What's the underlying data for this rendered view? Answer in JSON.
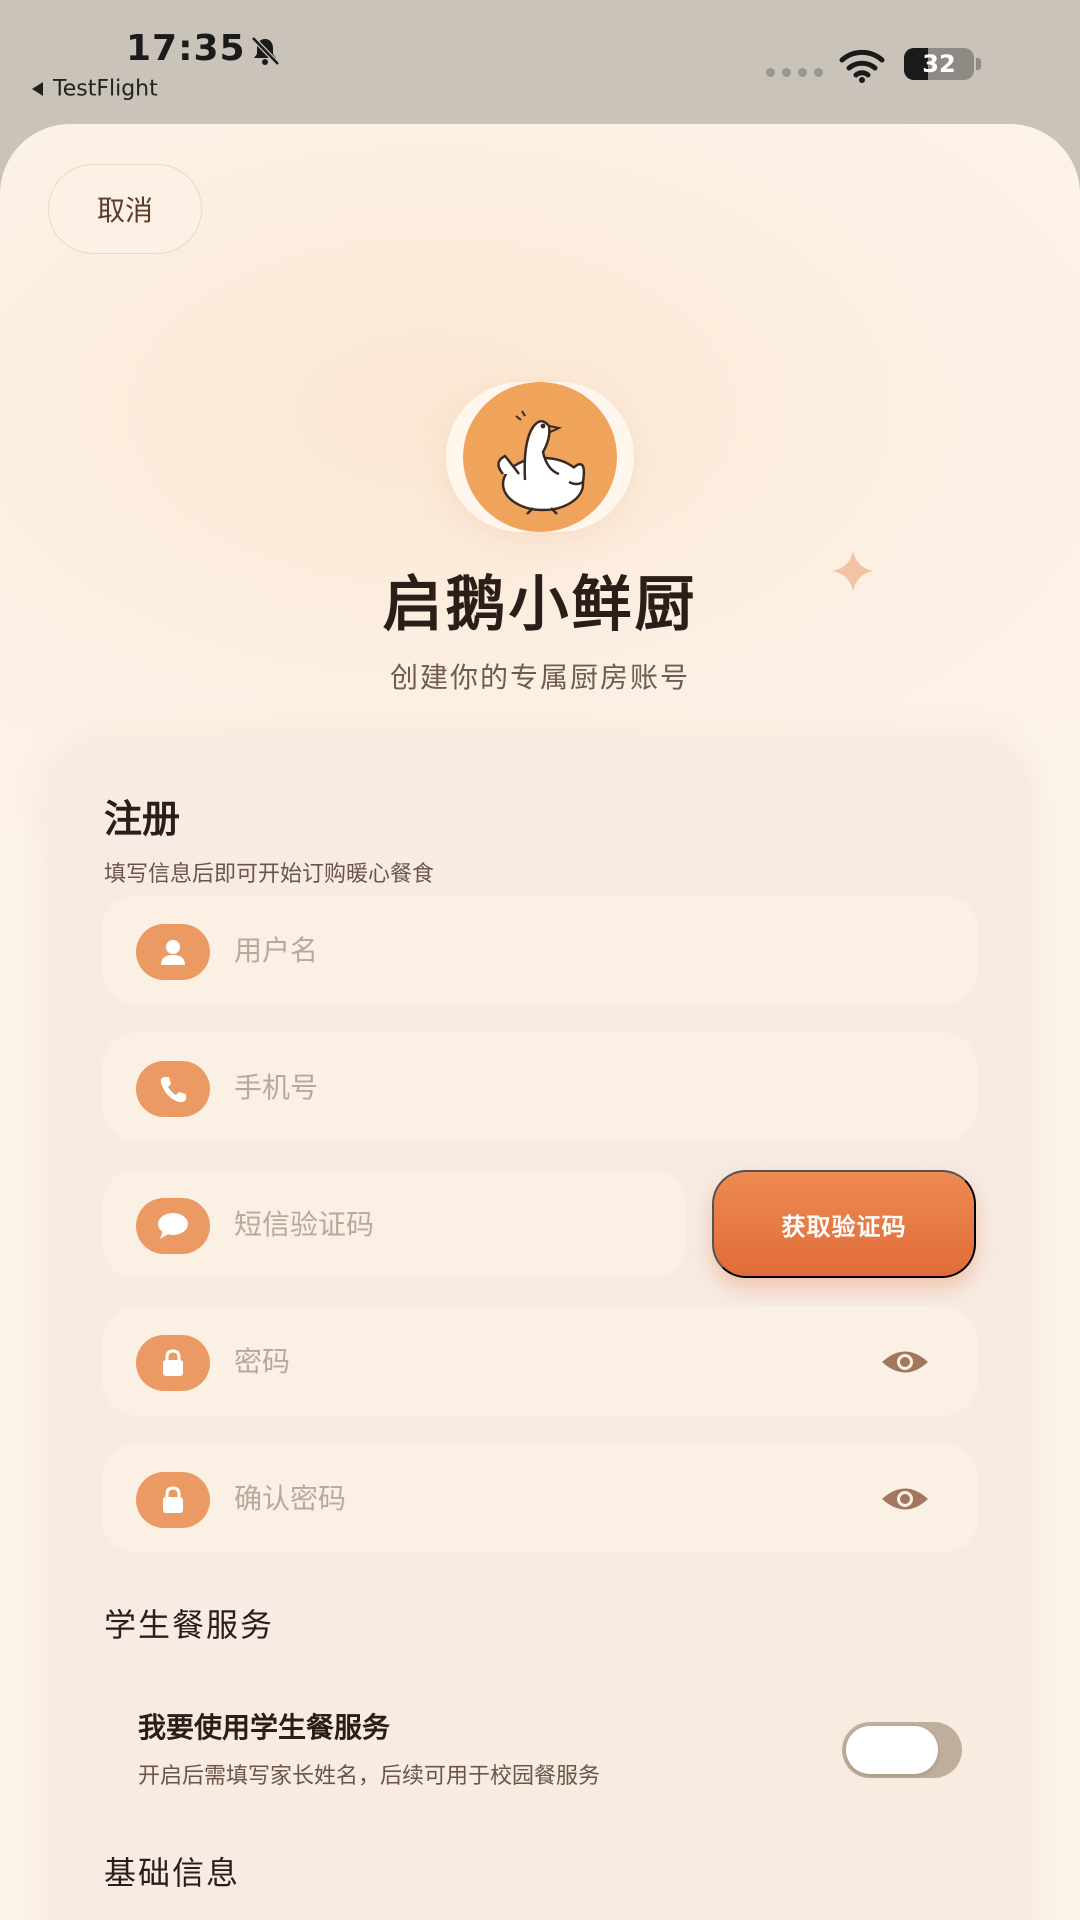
{
  "status_bar": {
    "time": "17:35",
    "back_app": "TestFlight",
    "battery": "32"
  },
  "header": {
    "cancel_label": "取消",
    "app_name": "启鹅小鲜厨",
    "tagline": "创建你的专属厨房账号"
  },
  "register": {
    "title": "注册",
    "subtitle": "填写信息后即可开始订购暖心餐食",
    "fields": {
      "username_placeholder": "用户名",
      "phone_placeholder": "手机号",
      "sms_code_placeholder": "短信验证码",
      "password_placeholder": "密码",
      "confirm_password_placeholder": "确认密码"
    },
    "get_code_label": "获取验证码"
  },
  "student_meal": {
    "section_title": "学生餐服务",
    "option_title": "我要使用学生餐服务",
    "option_desc": "开启后需填写家长姓名，后续可用于校园餐服务",
    "enabled": false
  },
  "basic_info": {
    "section_title": "基础信息"
  },
  "colors": {
    "accent": "#ec9a64",
    "button": "#e37a45",
    "sheet_bg": "#fcf0e3"
  },
  "icons": [
    "bell-slash-icon",
    "signal-icon",
    "wifi-icon",
    "battery-icon",
    "goose-logo-icon",
    "sparkle-icon",
    "user-icon",
    "phone-icon",
    "chat-bubble-icon",
    "lock-icon",
    "eye-icon"
  ]
}
